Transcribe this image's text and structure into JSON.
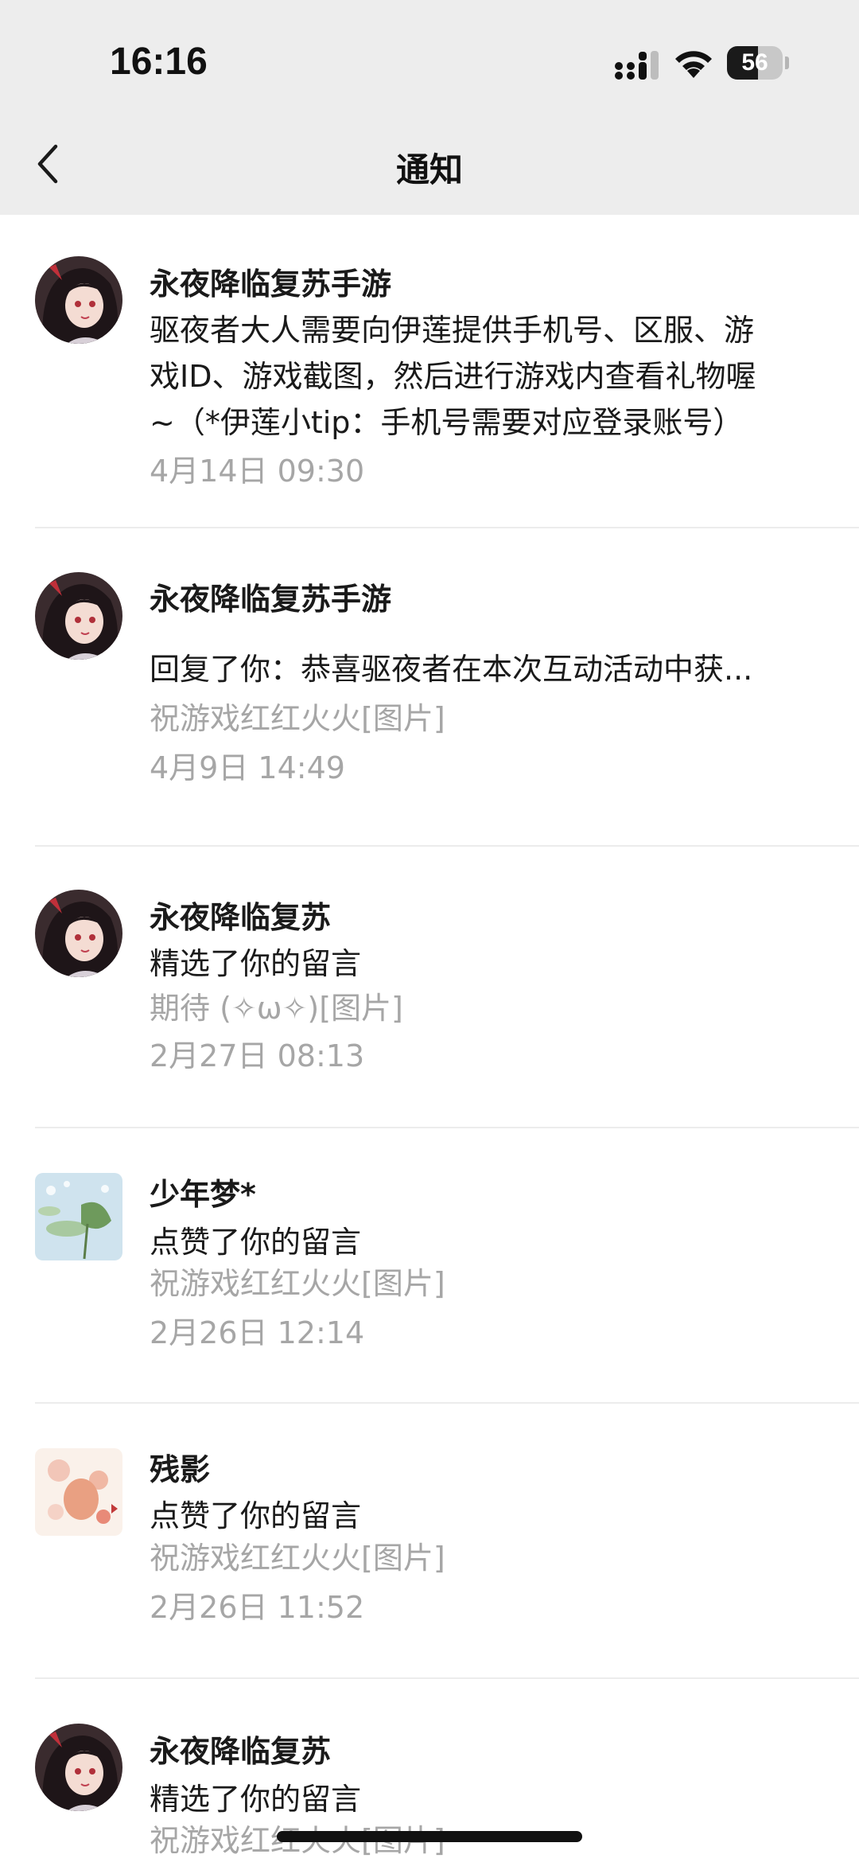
{
  "status_bar": {
    "time": "16:16",
    "battery": "56",
    "battery_level": 0.56
  },
  "header": {
    "title": "通知"
  },
  "notifications": [
    {
      "sender": "永夜降临复苏手游",
      "lines": [
        "驱夜者大人需要向伊莲提供手机号、区服、游",
        "戏ID、游戏截图，然后进行游戏内查看礼物喔",
        "~（*伊莲小tip：手机号需要对应登录账号）"
      ],
      "time": "4月14日 09:30"
    },
    {
      "sender": "永夜降临复苏手游",
      "action": "回复了你：恭喜驱夜者在本次互动活动中获...",
      "quote": "祝游戏红红火火[图片]",
      "time": "4月9日 14:49"
    },
    {
      "sender": "永夜降临复苏",
      "action": "精选了你的留言",
      "quote": "期待 (✧ω✧)[图片]",
      "time": "2月27日 08:13"
    },
    {
      "sender": "少年梦*",
      "action": "点赞了你的留言",
      "quote": "祝游戏红红火火[图片]",
      "time": "2月26日 12:14"
    },
    {
      "sender": "残影",
      "action": "点赞了你的留言",
      "quote": "祝游戏红红火火[图片]",
      "time": "2月26日 11:52"
    },
    {
      "sender": "永夜降临复苏",
      "action": "精选了你的留言",
      "quote": "祝游戏红红火火[图片]"
    }
  ]
}
